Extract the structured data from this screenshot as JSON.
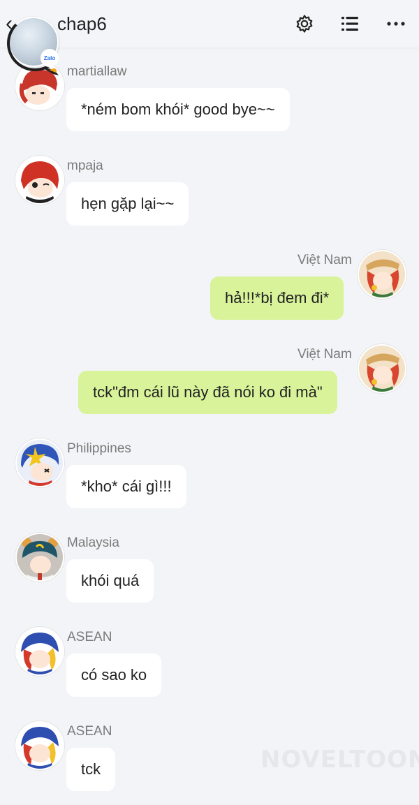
{
  "header": {
    "title": "chap6",
    "badge_text": "Zalo"
  },
  "colors": {
    "background": "#f3f4f7",
    "incoming_bubble": "#ffffff",
    "outgoing_bubble": "#d8f39a"
  },
  "messages": [
    {
      "sender": "martiallaw",
      "text": "*ném bom khói* good bye~~",
      "side": "left"
    },
    {
      "sender": "mpaja",
      "text": "hẹn gặp lại~~",
      "side": "left"
    },
    {
      "sender": "Việt Nam",
      "text": "hả!!!*bị đem đi*",
      "side": "right"
    },
    {
      "sender": "Việt Nam",
      "text": "tck\"đm cái lũ này đã nói ko đi mà\"",
      "side": "right"
    },
    {
      "sender": "Philippines",
      "text": "*kho* cái gì!!!",
      "side": "left"
    },
    {
      "sender": "Malaysia",
      "text": "khói quá",
      "side": "left"
    },
    {
      "sender": "ASEAN",
      "text": "có sao ko",
      "side": "left"
    },
    {
      "sender": "ASEAN",
      "text": "tck",
      "side": "left"
    }
  ],
  "watermark": "NOVELTOON"
}
